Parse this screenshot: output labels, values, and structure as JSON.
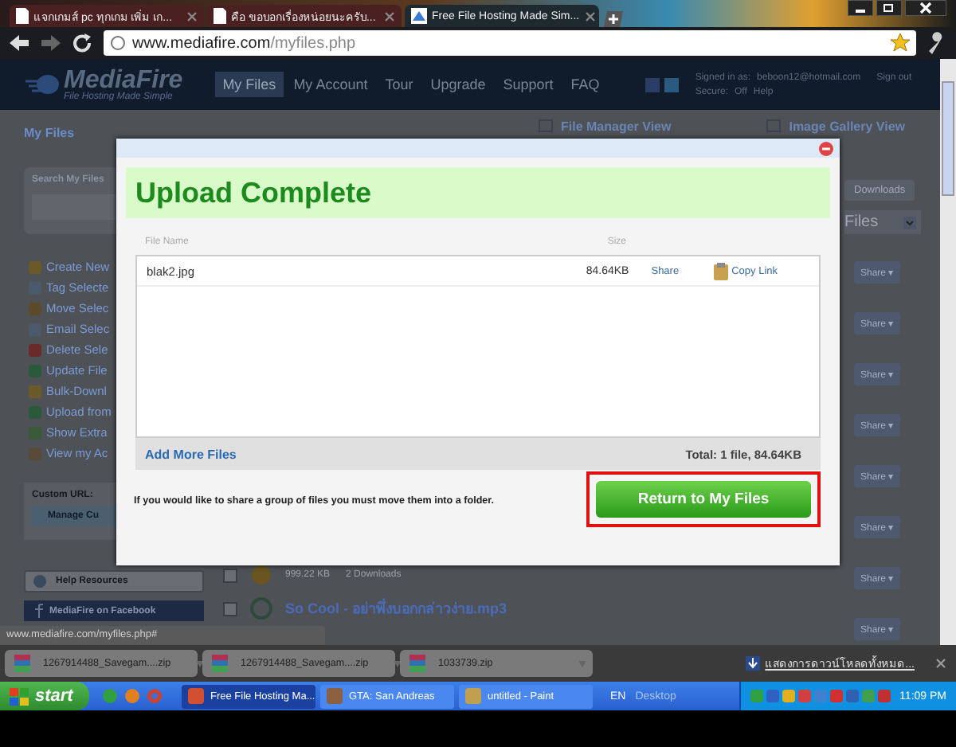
{
  "browser": {
    "tabs": [
      {
        "title": "แจกเกมส์ pc ทุกเกม เพิ่ม เก...",
        "selected": false
      },
      {
        "title": "คือ ขอบอกเรื่องหน่อยนะครับ...",
        "selected": false
      },
      {
        "title": "Free File Hosting Made Sim...",
        "selected": true
      }
    ],
    "url_host": "www.mediafire.com",
    "url_path": "/myfiles.php"
  },
  "site": {
    "logo": "MediaFire",
    "tagline": "File Hosting Made Simple",
    "nav": [
      {
        "label": "My Files",
        "selected": true
      },
      {
        "label": "My Account",
        "selected": false
      },
      {
        "label": "Tour",
        "selected": false
      },
      {
        "label": "Upgrade",
        "selected": false
      },
      {
        "label": "Support",
        "selected": false
      },
      {
        "label": "FAQ",
        "selected": false
      }
    ],
    "signed_in_label": "Signed in as:",
    "account": "beboon12@hotmail.com",
    "sign_out": "Sign out",
    "secure_label": "Secure:",
    "secure_value": "Off",
    "help": "Help"
  },
  "page": {
    "heading": "My Files",
    "views": [
      "File Manager View",
      "Image Gallery View"
    ],
    "search_label": "Search My Files",
    "actions": [
      "Create New",
      "Tag Selecte",
      "Move Selec",
      "Email Selec",
      "Delete Sele",
      "Update File",
      "Bulk-Downl",
      "Upload from",
      "Show Extra",
      "View my Ac"
    ],
    "custom_url_label": "Custom URL:",
    "manage_button": "Manage Cu",
    "help_resources": "Help Resources",
    "facebook": "MediaFire on Facebook",
    "downloads_button": "Downloads",
    "filter": "Files",
    "share_buttons": [
      "Share ▾",
      "Share ▾",
      "Share ▾",
      "Share ▾",
      "Share ▾",
      "Share ▾",
      "Share ▾",
      "Share ▾"
    ],
    "files": [
      {
        "size": "999.22 KB",
        "downloads": "2 Downloads",
        "checked": false
      },
      {
        "name": "So Cool - อย่าพึ่งบอกกล่าวง่าย.mp3",
        "checked": false
      }
    ]
  },
  "dialog": {
    "title": "Upload Complete",
    "columns": [
      "File Name",
      "Size"
    ],
    "files": [
      {
        "name": "blak2.jpg",
        "size": "84.64KB",
        "share": "Share",
        "copy_link": "Copy Link"
      }
    ],
    "add_more": "Add More Files",
    "total": "Total: 1 file, 84.64KB",
    "note": "If you would like to share a group of files you must move them into a folder.",
    "button": "Return to My Files",
    "button_highlighted": true
  },
  "status_url": "www.mediafire.com/myfiles.php#",
  "downloads": [
    {
      "file": "1267914488_Savegam....zip"
    },
    {
      "file": "1267914488_Savegam....zip"
    },
    {
      "file": "1033739.zip"
    }
  ],
  "show_all_downloads": "แสดงการดาวน์โหลดทั้งหมด...",
  "taskbar": {
    "start": "start",
    "tasks": [
      {
        "label": "Free File Hosting Ma...",
        "selected": true
      },
      {
        "label": "GTA: San Andreas",
        "selected": false
      },
      {
        "label": "untitled - Paint",
        "selected": false
      }
    ],
    "language": "EN",
    "toolbar": "Desktop",
    "clock": "11:09 PM"
  }
}
